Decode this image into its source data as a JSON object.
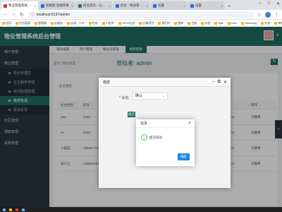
{
  "browser": {
    "tabs": [
      {
        "title": "物业管理系统后台",
        "color": "r",
        "active": true
      },
      {
        "title": "如图图 后端项目",
        "color": "b",
        "active": false
      },
      {
        "title": "前台首页 - 山东口",
        "color": "g",
        "active": false
      },
      {
        "title": "后台 · 物业管理平台",
        "color": "b",
        "active": false
      },
      {
        "title": "设置",
        "color": "b",
        "active": false
      },
      {
        "title": "设置",
        "color": "b",
        "active": false
      }
    ],
    "url": "localhost:8197/admin",
    "bookmarks": [
      "应用",
      "后台管理",
      "管理端",
      "云服务",
      "云课 - 小学",
      "在线",
      "小程序",
      "JSON在线",
      "后端项目",
      "我们的",
      "图库",
      "百度",
      "文档",
      "Ajax",
      "csdn",
      "dreaming",
      "外部",
      "其他收藏夹"
    ]
  },
  "app": {
    "brand": "物业管理系统后台管理",
    "sidebar": [
      {
        "label": "用户管理",
        "type": "group"
      },
      {
        "label": "物业管理",
        "type": "group"
      },
      {
        "label": "物业管理员",
        "type": "sub",
        "active": false
      },
      {
        "label": "业主服务管理",
        "type": "sub",
        "active": false
      },
      {
        "label": "房间管理管理",
        "type": "sub",
        "active": false
      },
      {
        "label": "缴费管理",
        "type": "sub",
        "active": true
      },
      {
        "label": "投诉反馈",
        "type": "sub",
        "active": false
      },
      {
        "label": "社区管理",
        "type": "group"
      },
      {
        "label": "通知管理",
        "type": "group"
      },
      {
        "label": "系统管理",
        "type": "group"
      }
    ],
    "page_tabs": [
      {
        "label": "我的桌面",
        "active": false
      },
      {
        "label": "用户管理",
        "active": false
      },
      {
        "label": "物业员管理",
        "active": false
      },
      {
        "label": "缴费管理",
        "active": true
      }
    ],
    "breadcrumb": "首页 / 物业管理",
    "page_title": "登陆者: admin",
    "filter_label": "业主姓名",
    "table": {
      "headers": [
        "业主姓名",
        "房号",
        "",
        "",
        "",
        "",
        "",
        "",
        "操作"
      ],
      "rows": [
        [
          "aaa",
          "2233",
          "",
          "",
          "",
          "",
          "",
          "2023-03-11",
          "已缴费"
        ],
        [
          "as",
          "2233",
          "",
          "",
          "",
          "",
          "",
          "2023-03-11",
          "已缴费"
        ],
        [
          "小猫猫",
          "18888771943",
          "",
          "",
          "",
          "",
          "",
          "2023-03-11",
          "已缴费"
        ],
        [
          "浙小江",
          "13356649444",
          "",
          "",
          "",
          "",
          "",
          "2023-03-11",
          "已缴费"
        ]
      ]
    }
  },
  "modal_edit": {
    "title": "缴费",
    "field_label": "* 状态",
    "select_value": "确认",
    "button": "提交"
  },
  "modal_alert": {
    "title": "信息",
    "message": "提交成功",
    "ok": "确定"
  }
}
